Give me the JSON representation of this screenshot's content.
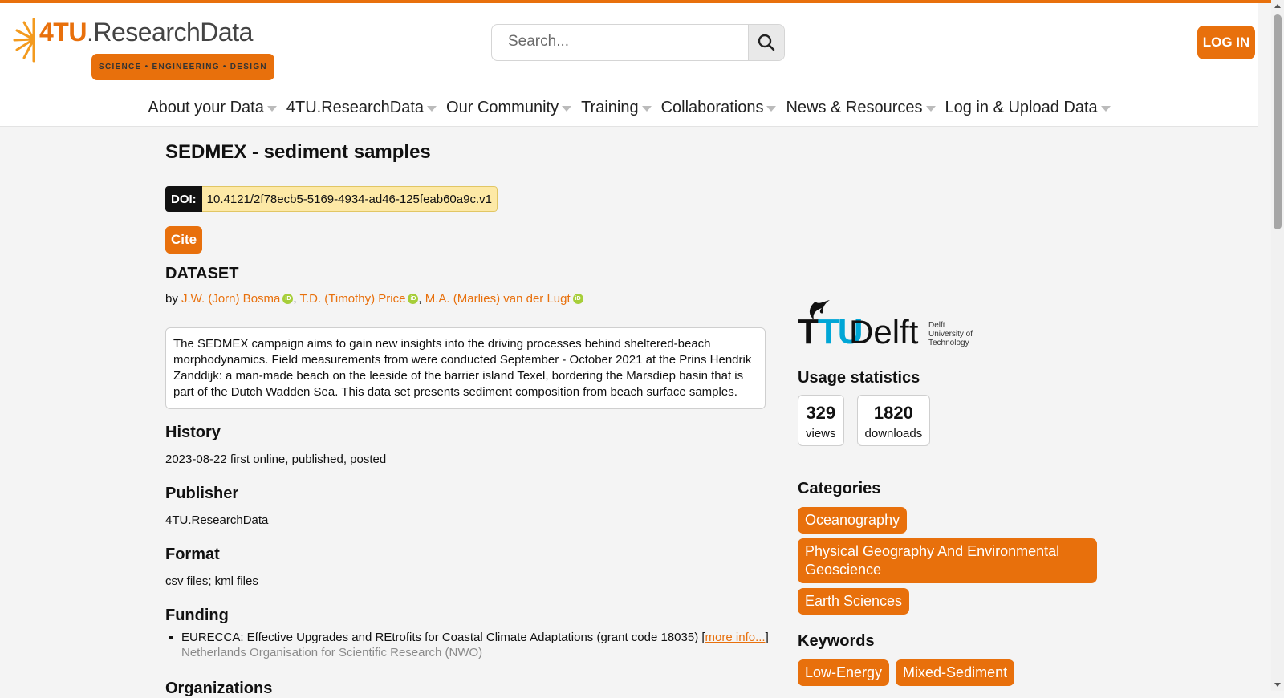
{
  "header": {
    "logo_brand_prefix": "4TU",
    "logo_brand_suffix": ".ResearchData",
    "logo_tagline": "SCIENCE • ENGINEERING • DESIGN",
    "search_placeholder": "Search...",
    "login_label": "LOG IN",
    "accent_color": "#e8700c"
  },
  "nav": {
    "items": [
      {
        "label": "About your Data"
      },
      {
        "label": "4TU.ResearchData"
      },
      {
        "label": "Our Community"
      },
      {
        "label": "Training"
      },
      {
        "label": "Collaborations"
      },
      {
        "label": "News & Resources"
      },
      {
        "label": "Log in & Upload Data"
      }
    ]
  },
  "dataset": {
    "title": "SEDMEX - sediment samples",
    "doi_label": "DOI:",
    "doi_value": "10.4121/2f78ecb5-5169-4934-ad46-125feab60a9c.v1",
    "cite_label": "Cite",
    "type_label": "DATASET",
    "by_label": "by",
    "authors": [
      {
        "name": "J.W. (Jorn) Bosma"
      },
      {
        "name": "T.D. (Timothy) Price"
      },
      {
        "name": "M.A. (Marlies) van der Lugt"
      }
    ],
    "description": "The SEDMEX campaign aims to gain new insights into the driving processes behind sheltered-beach morphodynamics. Field measurements from were conducted September - October 2021 at the Prins Hendrik Zanddijk: a man-made beach on the leeside of the barrier island Texel, bordering the Marsdiep basin that is part of the Dutch Wadden Sea. This data set presents sediment composition from beach surface samples.",
    "history_title": "History",
    "history_value": "2023-08-22 first online, published, posted",
    "publisher_title": "Publisher",
    "publisher_value": "4TU.ResearchData",
    "format_title": "Format",
    "format_value": "csv files; kml files",
    "funding_title": "Funding",
    "funding_item": "EURECCA: Effective Upgrades and REtrofits for Coastal Climate Adaptations (grant code 18035) [",
    "funding_more": "more info...",
    "funding_close": "]",
    "funding_org": "Netherlands Organisation for Scientific Research (NWO)",
    "organizations_title": "Organizations"
  },
  "sidebar": {
    "institution_name": "Delft",
    "institution_sub": [
      "Delft",
      "University of",
      "Technology"
    ],
    "institution_tu": "TU",
    "usage_title": "Usage statistics",
    "views_count": "329",
    "views_label": "views",
    "downloads_count": "1820",
    "downloads_label": "downloads",
    "categories_title": "Categories",
    "categories": [
      "Oceanography",
      "Physical Geography And Environmental Geoscience",
      "Earth Sciences"
    ],
    "keywords_title": "Keywords",
    "keywords": [
      "Low-Energy",
      "Mixed-Sediment"
    ]
  }
}
